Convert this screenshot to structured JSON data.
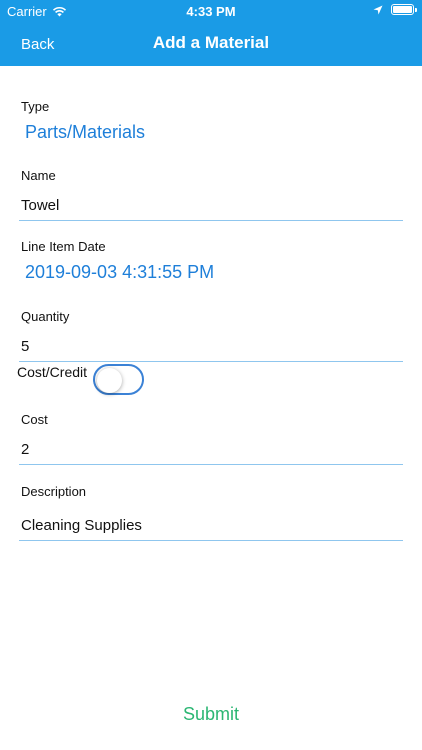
{
  "status_bar": {
    "carrier": "Carrier",
    "time": "4:33 PM"
  },
  "nav": {
    "back_label": "Back",
    "title": "Add a Material"
  },
  "form": {
    "type": {
      "label": "Type",
      "value": "Parts/Materials"
    },
    "name": {
      "label": "Name",
      "value": "Towel"
    },
    "line_item_date": {
      "label": "Line Item Date",
      "value": "2019-09-03 4:31:55 PM"
    },
    "quantity": {
      "label": "Quantity",
      "value": "5"
    },
    "cost_credit": {
      "label": "Cost/Credit",
      "on": false
    },
    "cost": {
      "label": "Cost",
      "value": "2"
    },
    "description": {
      "label": "Description",
      "value": "Cleaning Supplies"
    }
  },
  "submit_label": "Submit",
  "colors": {
    "header": "#1a9be6",
    "link": "#1e7fd9",
    "submit": "#2bb673",
    "underline": "#8fc6ee"
  }
}
